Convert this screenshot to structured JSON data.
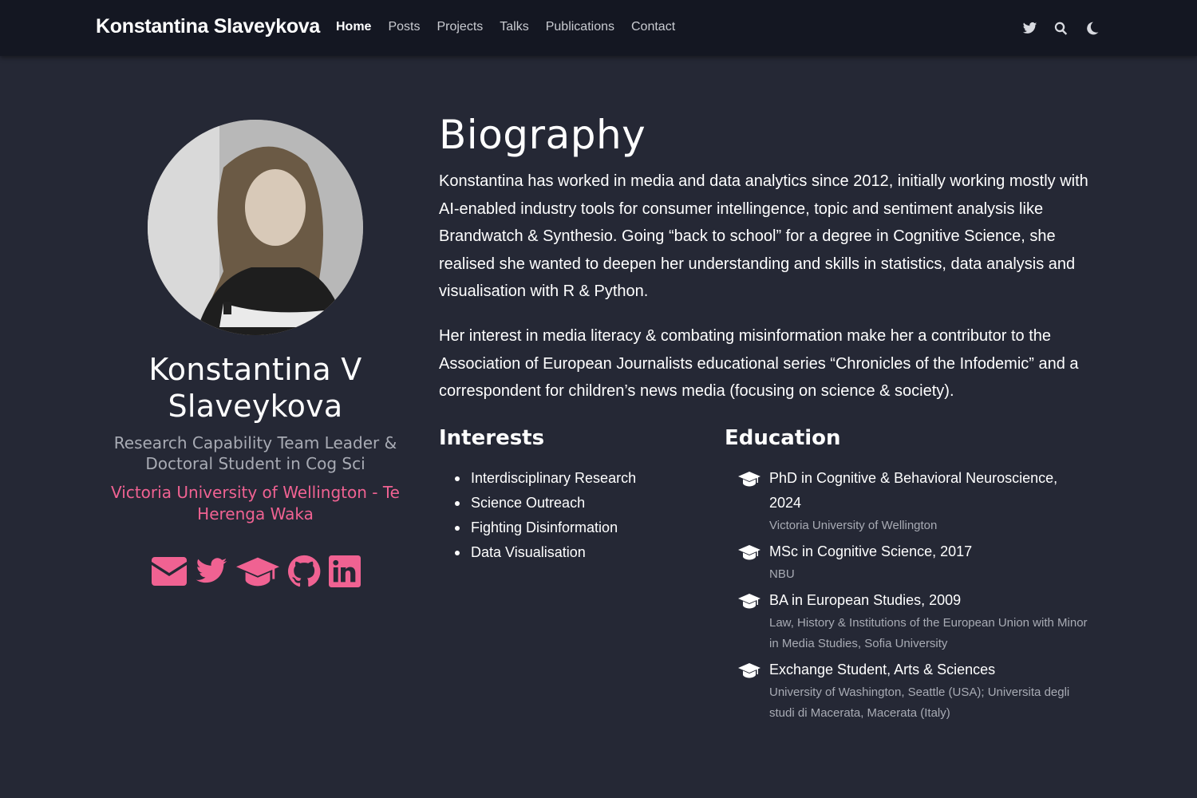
{
  "navbar": {
    "brand": "Konstantina Slaveykova",
    "links": [
      {
        "label": "Home",
        "active": true
      },
      {
        "label": "Posts"
      },
      {
        "label": "Projects"
      },
      {
        "label": "Talks"
      },
      {
        "label": "Publications"
      },
      {
        "label": "Contact"
      }
    ],
    "icons": [
      "twitter-icon",
      "search-icon",
      "moon-icon"
    ]
  },
  "profile": {
    "name": "Konstantina V Slaveykova",
    "role": "Research Capability Team Leader & Doctoral Student in Cog Sci",
    "organization": "Victoria University of Wellington - Te Herenga Waka",
    "social_icons": [
      "envelope-icon",
      "twitter-icon",
      "graduation-cap-icon",
      "github-icon",
      "linkedin-icon"
    ],
    "accent_color": "#f06292"
  },
  "biography": {
    "title": "Biography",
    "paragraphs": [
      "Konstantina has worked in media and data analytics since 2012, initially working mostly with AI-enabled industry tools for consumer intellingence, topic and sentiment analysis like Brandwatch & Synthesio. Going “back to school” for a degree in Cognitive Science, she realised she wanted to deepen her understanding and skills in statistics, data analysis and visualisation with R & Python.",
      "Her interest in media literacy & combating misinformation make her a contributor to the Association of European Journalists educational series “Chronicles of the Infodemic” and a correspondent for children’s news media (focusing on science & society)."
    ]
  },
  "interests": {
    "title": "Interests",
    "items": [
      "Interdisciplinary Research",
      "Science Outreach",
      "Fighting Disinformation",
      "Data Visualisation"
    ]
  },
  "education": {
    "title": "Education",
    "items": [
      {
        "degree": "PhD in Cognitive & Behavioral Neuroscience, 2024",
        "school": "Victoria University of Wellington"
      },
      {
        "degree": "MSc in Cognitive Science, 2017",
        "school": "NBU"
      },
      {
        "degree": "BA in European Studies, 2009",
        "school": "Law, History & Institutions of the European Union with Minor in Media Studies, Sofia University"
      },
      {
        "degree": "Exchange Student, Arts & Sciences",
        "school": "University of Washington, Seattle (USA); Universita degli studi di Macerata, Macerata (Italy)"
      }
    ]
  },
  "colors": {
    "background": "#252835",
    "navbar": "#141722",
    "accent": "#f06292",
    "muted_text": "#a8abb4"
  }
}
